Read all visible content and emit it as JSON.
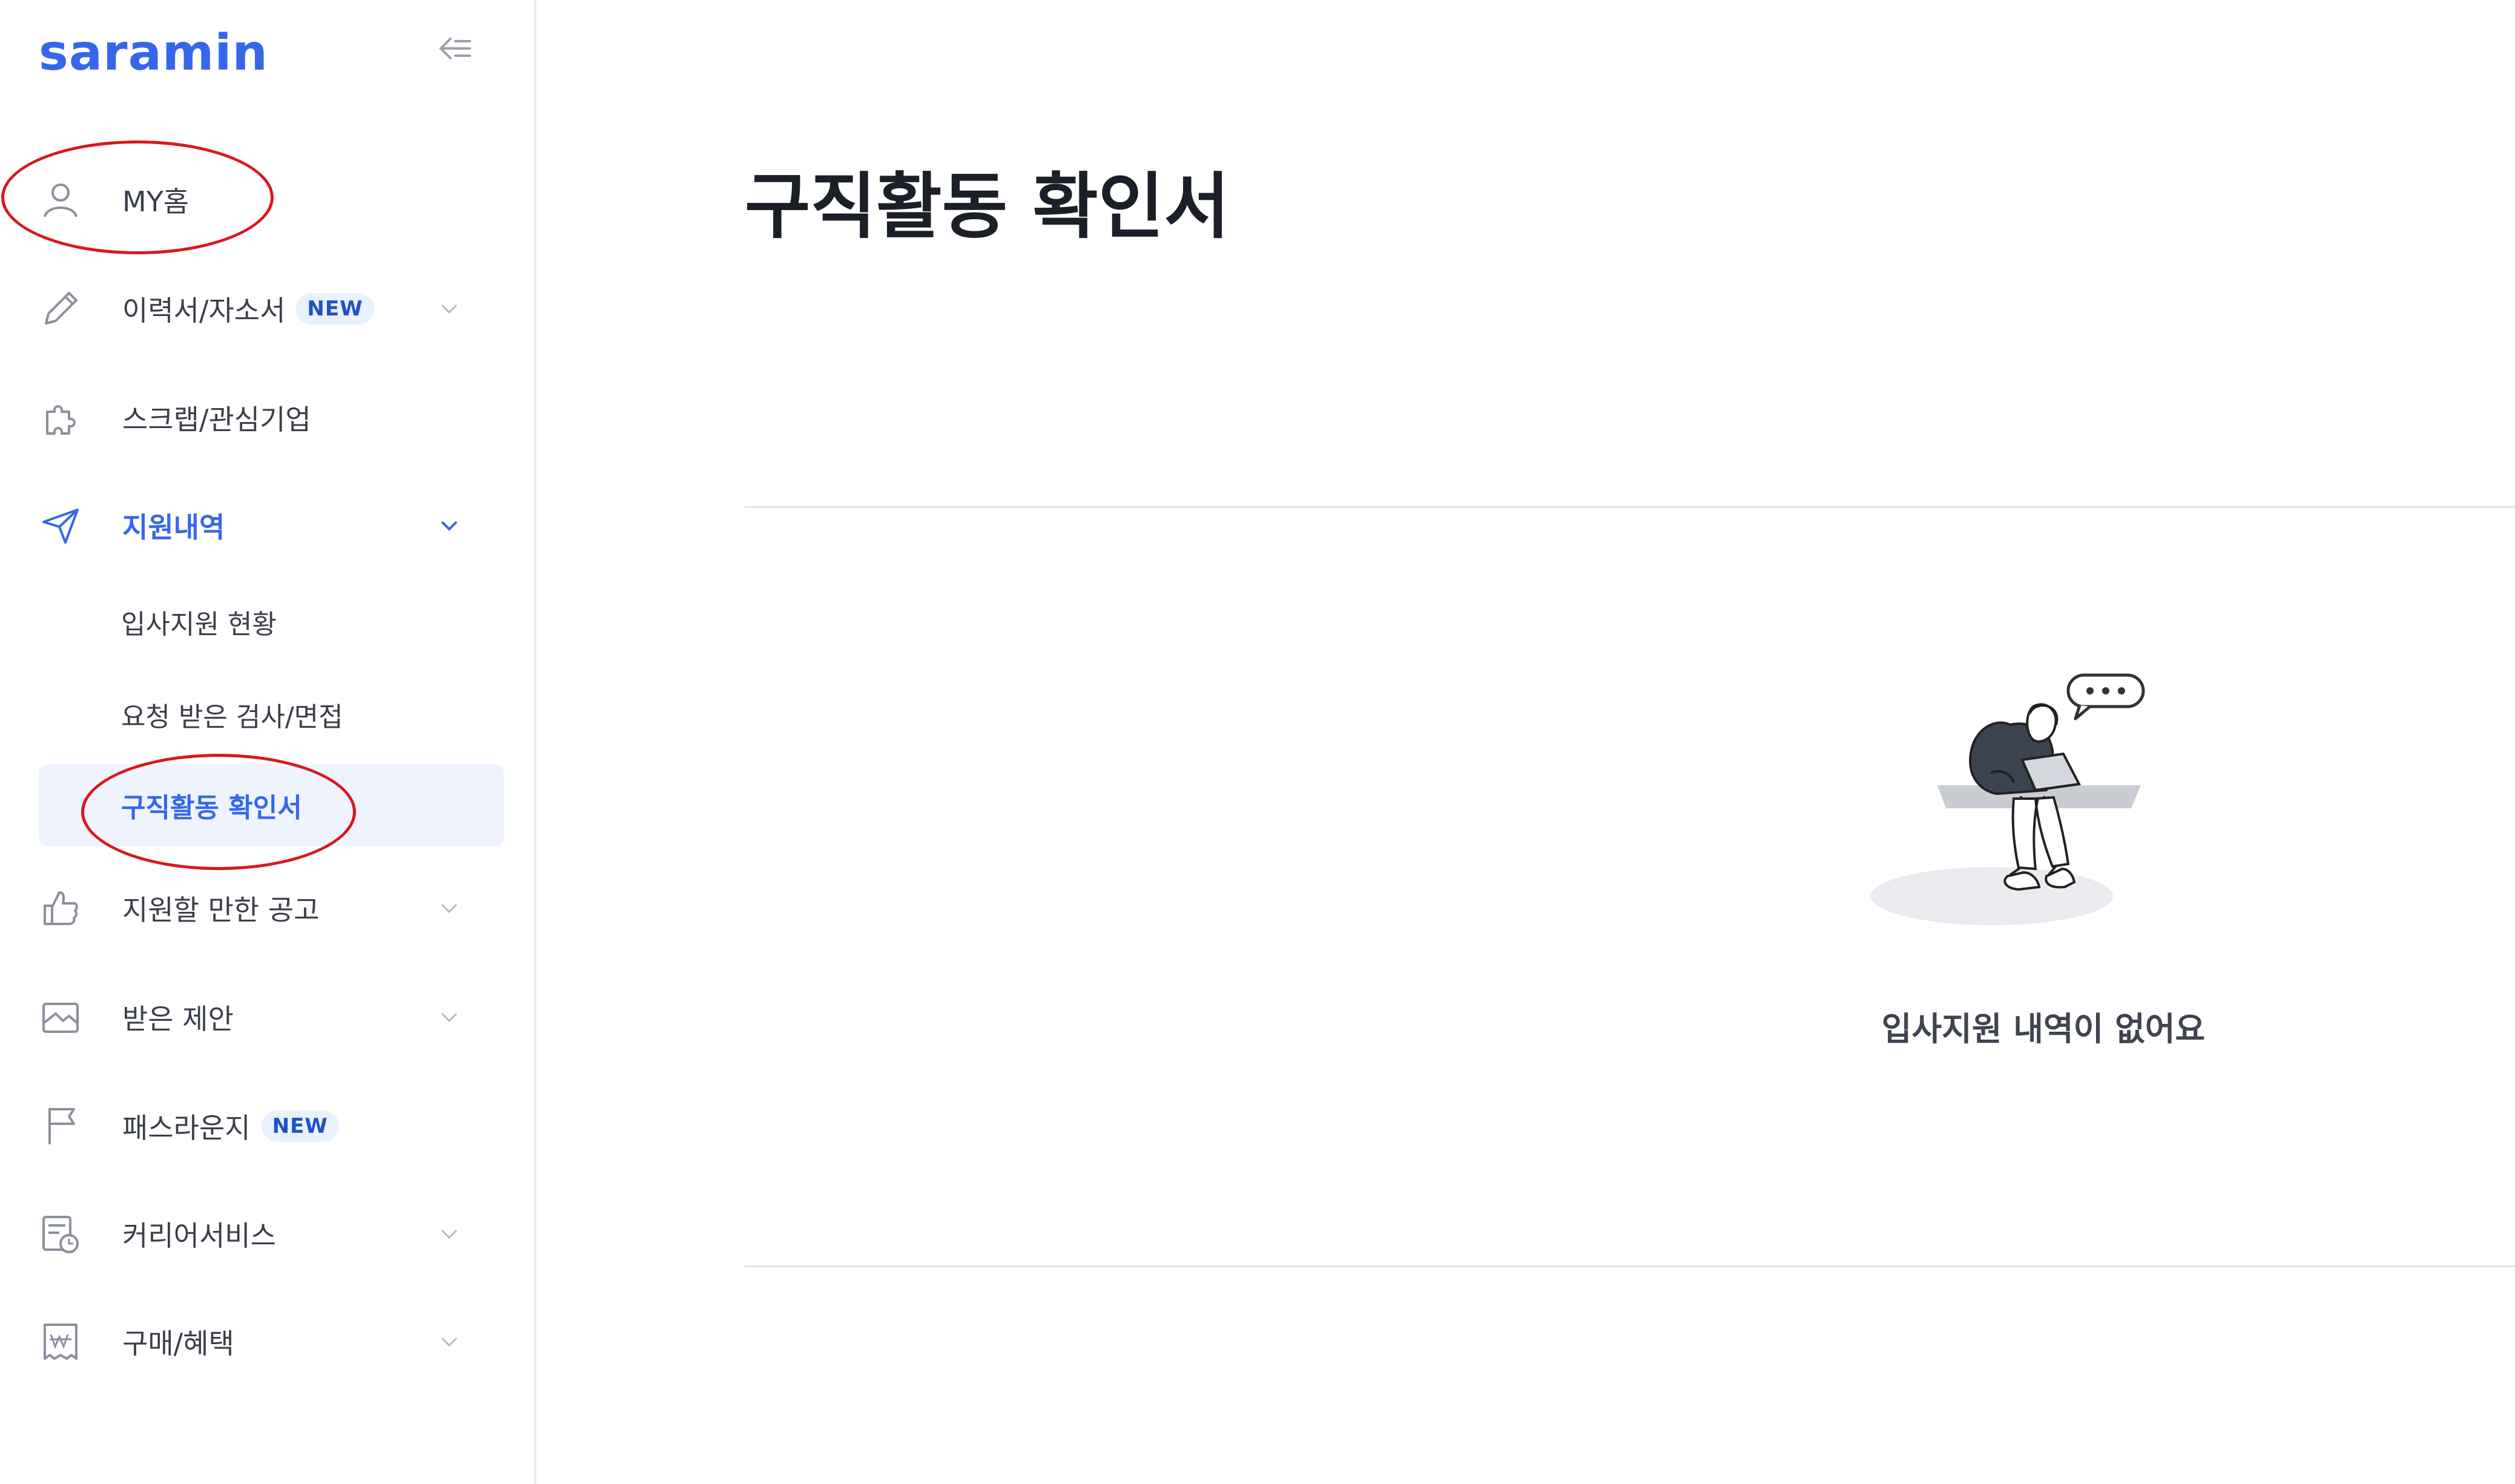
{
  "app": {
    "logo_text": "saramin"
  },
  "sidebar": {
    "items": [
      {
        "label": "MY홈",
        "icon": "user-icon"
      },
      {
        "label": "이력서/자소서",
        "badge": "NEW",
        "icon": "pencil-icon"
      },
      {
        "label": "스크랩/관심기업",
        "icon": "puzzle-icon"
      },
      {
        "label": "지원내역",
        "icon": "send-icon"
      },
      {
        "label": "지원할 만한 공고",
        "icon": "thumbs-up-icon"
      },
      {
        "label": "받은 제안",
        "icon": "envelope-icon"
      },
      {
        "label": "패스라운지",
        "badge": "NEW",
        "icon": "flag-icon"
      },
      {
        "label": "커리어서비스",
        "icon": "calendar-clock-icon"
      },
      {
        "label": "구매/혜택",
        "icon": "won-coupon-icon"
      }
    ],
    "sub_items": [
      {
        "label": "입사지원 현황"
      },
      {
        "label": "요청 받은 검사/면접"
      },
      {
        "label": "구직활동 확인서"
      }
    ]
  },
  "main": {
    "title": "구직활동 확인서",
    "empty_message": "입사지원 내역이 없어요"
  },
  "colors": {
    "brand": "#3567e8",
    "active_bg": "#eef3fe",
    "badge_bg": "#e9f0fe",
    "annotation_circle": "#d7191c"
  }
}
